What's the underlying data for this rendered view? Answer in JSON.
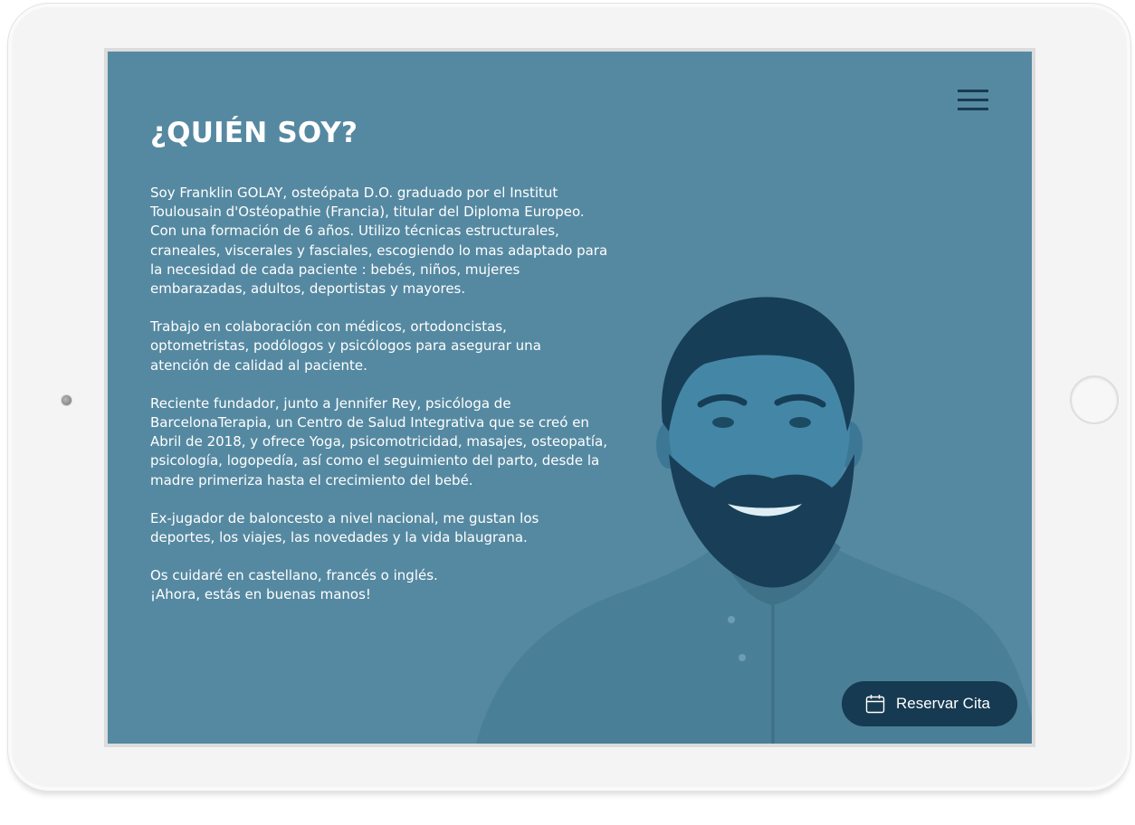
{
  "header": {
    "menu_icon": "hamburger-menu-icon"
  },
  "about": {
    "title": "¿QUIÉN SOY?",
    "paragraphs": [
      {
        "lines": [
          "Soy Franklin GOLAY, osteópata D.O. graduado por el Institut",
          "Toulousain d'Ostéopathie (Francia), titular del Diploma Europeo.",
          "Con una formación de 6 años. Utilizo técnicas estructurales,",
          "craneales, viscerales y fasciales, escogiendo lo mas adaptado para",
          "la necesidad de cada paciente : bebés, niños, mujeres",
          "embarazadas, adultos, deportistas y mayores."
        ]
      },
      {
        "lines": [
          "Trabajo en colaboración con médicos, ortodoncistas,",
          "optometristas, podólogos y psicólogos para asegurar una",
          "atención de calidad al paciente."
        ]
      },
      {
        "lines": [
          "Reciente fundador, junto a Jennifer Rey, psicóloga de",
          "BarcelonaTerapia, un Centro de Salud Integrativa que se creó en",
          "Abril de 2018, y ofrece Yoga, psicomotricidad, masajes, osteopatía,",
          "psicología, logopedía, así como el seguimiento del parto, desde la",
          "madre primeriza hasta el crecimiento del bebé."
        ]
      },
      {
        "lines": [
          "Ex-jugador de baloncesto a nivel nacional, me gustan los",
          "deportes, los viajes, las novedades y la vida blaugrana."
        ]
      },
      {
        "lines": [
          "Os cuidaré en castellano, francés o inglés.",
          "¡Ahora, estás en buenas manos!"
        ]
      }
    ]
  },
  "cta": {
    "label": "Reservar Cita",
    "icon": "calendar-icon"
  },
  "colors": {
    "background": "#5589a1",
    "accent_dark": "#163a51",
    "text": "#ffffff"
  }
}
